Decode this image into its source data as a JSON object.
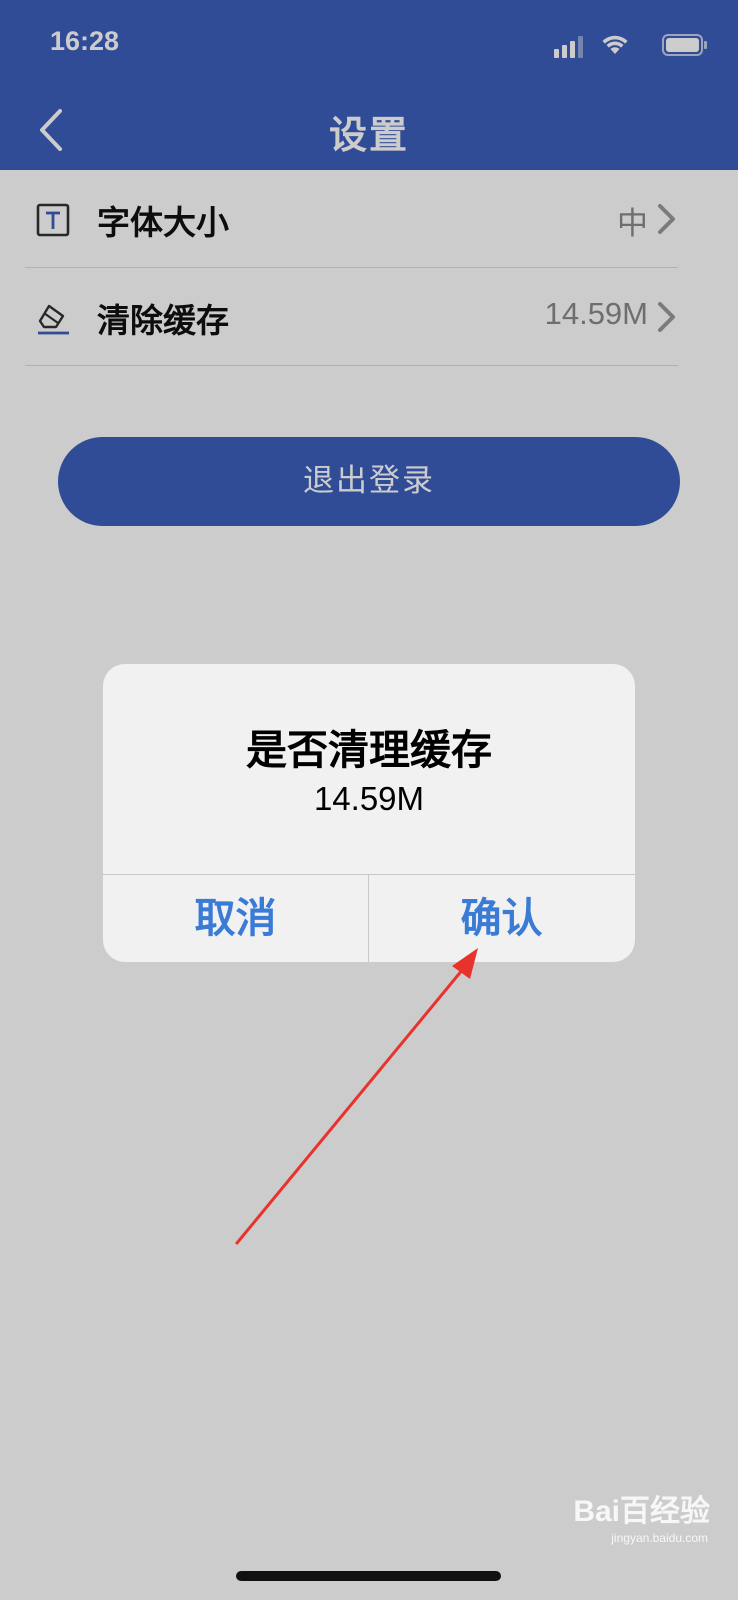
{
  "status_bar": {
    "time": "16:28"
  },
  "header": {
    "title": "设置",
    "back_icon": "chevron-left-icon"
  },
  "settings": {
    "items": [
      {
        "label": "字体大小",
        "value": "中",
        "icon": "text-size-icon"
      },
      {
        "label": "清除缓存",
        "value": "14.59M",
        "icon": "eraser-icon"
      }
    ],
    "logout_label": "退出登录"
  },
  "dialog": {
    "title": "是否清理缓存",
    "message": "14.59M",
    "cancel_label": "取消",
    "confirm_label": "确认"
  },
  "watermark": {
    "brand": "Bai百经验",
    "sub": "jingyan.baidu.com"
  },
  "colors": {
    "primary": "#3c5fbc",
    "dialog_button": "#3a7bd5",
    "annotation": "#e8322c"
  }
}
